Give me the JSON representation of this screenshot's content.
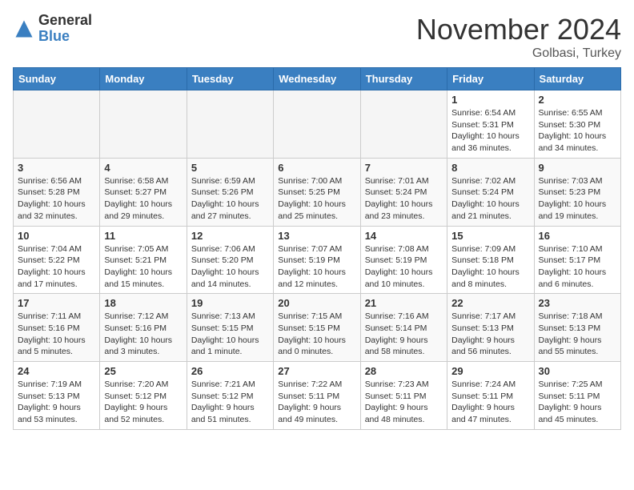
{
  "header": {
    "logo_general": "General",
    "logo_blue": "Blue",
    "month_title": "November 2024",
    "location": "Golbasi, Turkey"
  },
  "weekdays": [
    "Sunday",
    "Monday",
    "Tuesday",
    "Wednesday",
    "Thursday",
    "Friday",
    "Saturday"
  ],
  "weeks": [
    [
      {
        "day": "",
        "info": ""
      },
      {
        "day": "",
        "info": ""
      },
      {
        "day": "",
        "info": ""
      },
      {
        "day": "",
        "info": ""
      },
      {
        "day": "",
        "info": ""
      },
      {
        "day": "1",
        "info": "Sunrise: 6:54 AM\nSunset: 5:31 PM\nDaylight: 10 hours\nand 36 minutes."
      },
      {
        "day": "2",
        "info": "Sunrise: 6:55 AM\nSunset: 5:30 PM\nDaylight: 10 hours\nand 34 minutes."
      }
    ],
    [
      {
        "day": "3",
        "info": "Sunrise: 6:56 AM\nSunset: 5:28 PM\nDaylight: 10 hours\nand 32 minutes."
      },
      {
        "day": "4",
        "info": "Sunrise: 6:58 AM\nSunset: 5:27 PM\nDaylight: 10 hours\nand 29 minutes."
      },
      {
        "day": "5",
        "info": "Sunrise: 6:59 AM\nSunset: 5:26 PM\nDaylight: 10 hours\nand 27 minutes."
      },
      {
        "day": "6",
        "info": "Sunrise: 7:00 AM\nSunset: 5:25 PM\nDaylight: 10 hours\nand 25 minutes."
      },
      {
        "day": "7",
        "info": "Sunrise: 7:01 AM\nSunset: 5:24 PM\nDaylight: 10 hours\nand 23 minutes."
      },
      {
        "day": "8",
        "info": "Sunrise: 7:02 AM\nSunset: 5:24 PM\nDaylight: 10 hours\nand 21 minutes."
      },
      {
        "day": "9",
        "info": "Sunrise: 7:03 AM\nSunset: 5:23 PM\nDaylight: 10 hours\nand 19 minutes."
      }
    ],
    [
      {
        "day": "10",
        "info": "Sunrise: 7:04 AM\nSunset: 5:22 PM\nDaylight: 10 hours\nand 17 minutes."
      },
      {
        "day": "11",
        "info": "Sunrise: 7:05 AM\nSunset: 5:21 PM\nDaylight: 10 hours\nand 15 minutes."
      },
      {
        "day": "12",
        "info": "Sunrise: 7:06 AM\nSunset: 5:20 PM\nDaylight: 10 hours\nand 14 minutes."
      },
      {
        "day": "13",
        "info": "Sunrise: 7:07 AM\nSunset: 5:19 PM\nDaylight: 10 hours\nand 12 minutes."
      },
      {
        "day": "14",
        "info": "Sunrise: 7:08 AM\nSunset: 5:19 PM\nDaylight: 10 hours\nand 10 minutes."
      },
      {
        "day": "15",
        "info": "Sunrise: 7:09 AM\nSunset: 5:18 PM\nDaylight: 10 hours\nand 8 minutes."
      },
      {
        "day": "16",
        "info": "Sunrise: 7:10 AM\nSunset: 5:17 PM\nDaylight: 10 hours\nand 6 minutes."
      }
    ],
    [
      {
        "day": "17",
        "info": "Sunrise: 7:11 AM\nSunset: 5:16 PM\nDaylight: 10 hours\nand 5 minutes."
      },
      {
        "day": "18",
        "info": "Sunrise: 7:12 AM\nSunset: 5:16 PM\nDaylight: 10 hours\nand 3 minutes."
      },
      {
        "day": "19",
        "info": "Sunrise: 7:13 AM\nSunset: 5:15 PM\nDaylight: 10 hours\nand 1 minute."
      },
      {
        "day": "20",
        "info": "Sunrise: 7:15 AM\nSunset: 5:15 PM\nDaylight: 10 hours\nand 0 minutes."
      },
      {
        "day": "21",
        "info": "Sunrise: 7:16 AM\nSunset: 5:14 PM\nDaylight: 9 hours\nand 58 minutes."
      },
      {
        "day": "22",
        "info": "Sunrise: 7:17 AM\nSunset: 5:13 PM\nDaylight: 9 hours\nand 56 minutes."
      },
      {
        "day": "23",
        "info": "Sunrise: 7:18 AM\nSunset: 5:13 PM\nDaylight: 9 hours\nand 55 minutes."
      }
    ],
    [
      {
        "day": "24",
        "info": "Sunrise: 7:19 AM\nSunset: 5:13 PM\nDaylight: 9 hours\nand 53 minutes."
      },
      {
        "day": "25",
        "info": "Sunrise: 7:20 AM\nSunset: 5:12 PM\nDaylight: 9 hours\nand 52 minutes."
      },
      {
        "day": "26",
        "info": "Sunrise: 7:21 AM\nSunset: 5:12 PM\nDaylight: 9 hours\nand 51 minutes."
      },
      {
        "day": "27",
        "info": "Sunrise: 7:22 AM\nSunset: 5:11 PM\nDaylight: 9 hours\nand 49 minutes."
      },
      {
        "day": "28",
        "info": "Sunrise: 7:23 AM\nSunset: 5:11 PM\nDaylight: 9 hours\nand 48 minutes."
      },
      {
        "day": "29",
        "info": "Sunrise: 7:24 AM\nSunset: 5:11 PM\nDaylight: 9 hours\nand 47 minutes."
      },
      {
        "day": "30",
        "info": "Sunrise: 7:25 AM\nSunset: 5:11 PM\nDaylight: 9 hours\nand 45 minutes."
      }
    ]
  ]
}
